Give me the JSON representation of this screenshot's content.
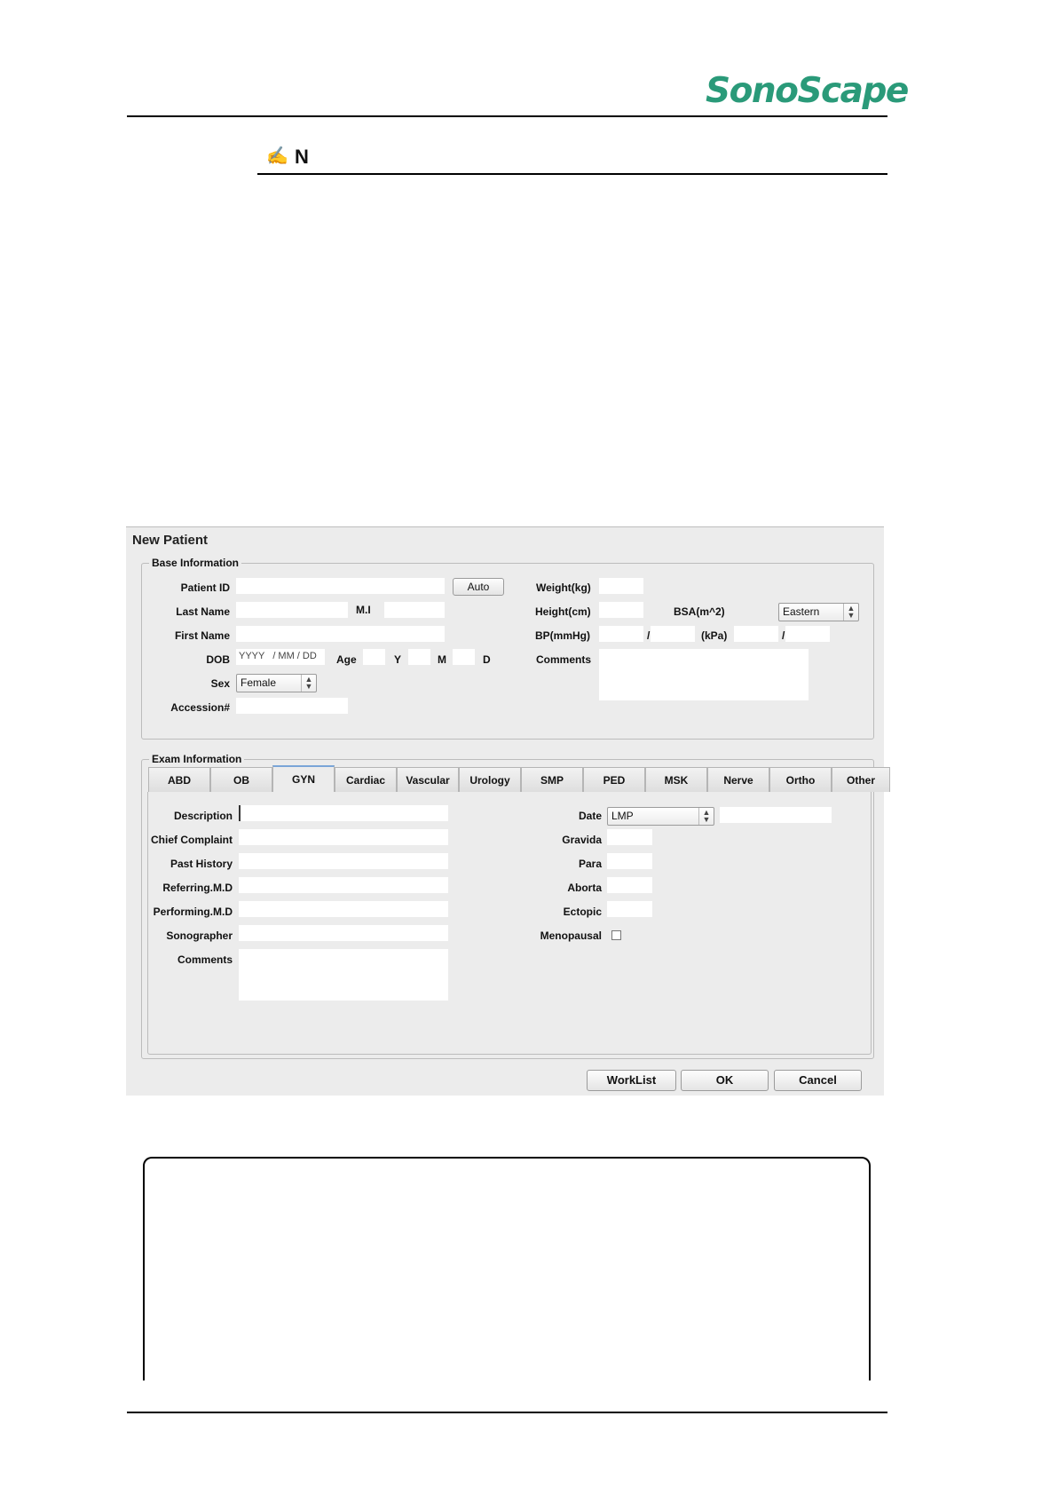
{
  "header": {
    "logo": "SonoScape",
    "note_icon": "✍",
    "note_title": "N"
  },
  "dialog": {
    "title": "New Patient",
    "base": {
      "legend": "Base Information",
      "patient_id_label": "Patient ID",
      "auto_button": "Auto",
      "last_name_label": "Last Name",
      "mi_label": "M.I",
      "first_name_label": "First Name",
      "dob_label": "DOB",
      "dob_placeholder": "YYYY   / MM / DD",
      "age_label": "Age",
      "y_label": "Y",
      "m_label": "M",
      "d_label": "D",
      "sex_label": "Sex",
      "sex_value": "Female",
      "accession_label": "Accession#",
      "weight_label": "Weight(kg)",
      "height_label": "Height(cm)",
      "bsa_label": "BSA(m^2)",
      "bsa_value": "Eastern",
      "bp_label": "BP(mmHg)",
      "slash": "/",
      "kpa_label": "(kPa)",
      "comments_label": "Comments"
    },
    "exam": {
      "legend": "Exam Information",
      "tabs": [
        "ABD",
        "OB",
        "GYN",
        "Cardiac",
        "Vascular",
        "Urology",
        "SMP",
        "PED",
        "MSK",
        "Nerve",
        "Ortho",
        "Other"
      ],
      "active_tab": "GYN",
      "description_label": "Description",
      "chief_complaint_label": "Chief Complaint",
      "past_history_label": "Past History",
      "referring_label": "Referring.M.D",
      "performing_label": "Performing.M.D",
      "sonographer_label": "Sonographer",
      "comments_label": "Comments",
      "date_label": "Date",
      "date_value": "LMP",
      "gravida_label": "Gravida",
      "para_label": "Para",
      "aborta_label": "Aborta",
      "ectopic_label": "Ectopic",
      "menopausal_label": "Menopausal"
    },
    "buttons": {
      "worklist": "WorkList",
      "ok": "OK",
      "cancel": "Cancel"
    }
  }
}
